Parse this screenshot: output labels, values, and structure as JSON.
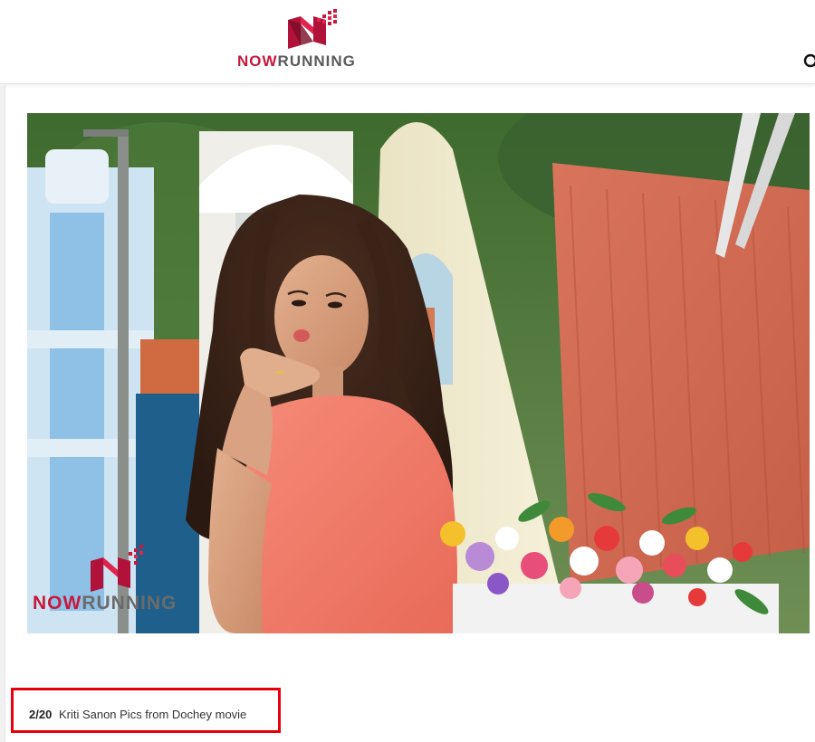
{
  "header": {
    "logo": {
      "now": "NOW",
      "running": "RUNNING"
    },
    "search_icon": "search-icon"
  },
  "photo": {
    "watermark": {
      "now": "NOW",
      "running": "RUNNING"
    }
  },
  "caption": {
    "count": "2/20",
    "title": "Kriti Sanon Pics from Dochey movie"
  },
  "colors": {
    "brand_red": "#c8193c",
    "logo_grey": "#5a5a5a",
    "highlight_box": "#e8000d"
  }
}
